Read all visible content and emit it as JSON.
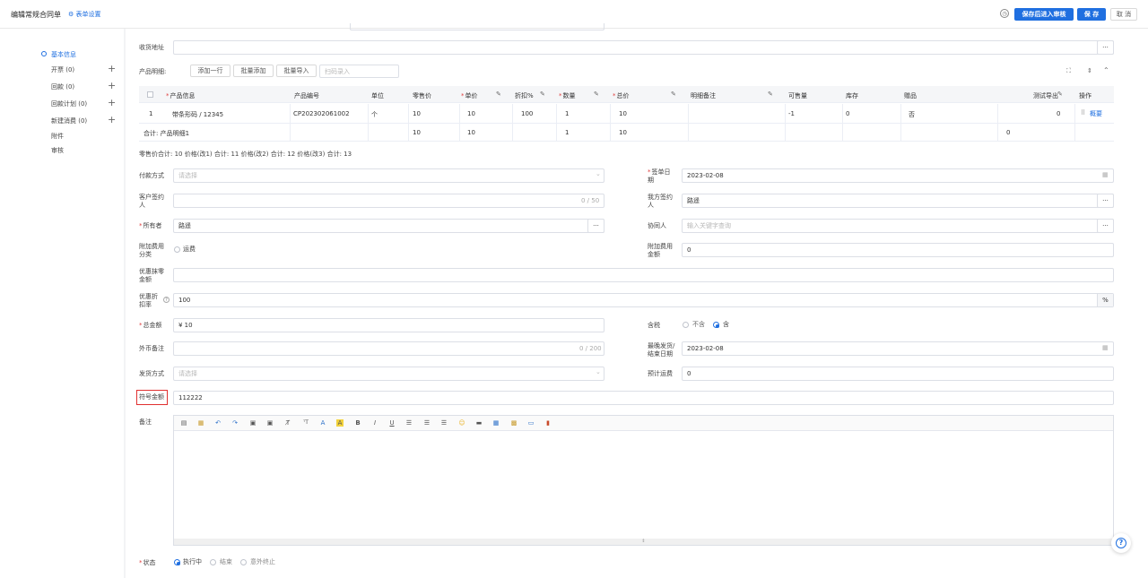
{
  "header": {
    "title": "编辑常规合同单",
    "form_settings": "表单设置",
    "btn_save_review": "保存后进入审核",
    "btn_save": "保 存",
    "btn_cancel": "取 消"
  },
  "sidebar": {
    "items": [
      {
        "label": "基本信息",
        "count": ""
      },
      {
        "label": "开票",
        "count": "(0)"
      },
      {
        "label": "回款",
        "count": "(0)"
      },
      {
        "label": "回款计划",
        "count": "(0)"
      },
      {
        "label": "新建消费",
        "count": "(0)"
      },
      {
        "label": "附件",
        "count": ""
      },
      {
        "label": "审核",
        "count": ""
      }
    ],
    "plus": "+"
  },
  "fields": {
    "shipping_address": {
      "label": "收货地址",
      "value": ""
    },
    "product_detail_label": "产品明细:",
    "add_row": "添加一行",
    "batch_add": "批量添加",
    "batch_import": "批量导入",
    "scan_placeholder": "扫码录入",
    "price_summary": "零售价合计: 10  价格(改1) 合计: 11  价格(改2) 合计: 12  价格(改3) 合计: 13",
    "payment_method": {
      "label": "付款方式",
      "placeholder": "请选择"
    },
    "sign_date": {
      "label": "签单日期",
      "value": "2023-02-08"
    },
    "customer_signer": {
      "label": "客户签约人",
      "counter": "0 / 50"
    },
    "our_signer": {
      "label": "我方签约人",
      "value": "路遥"
    },
    "owner": {
      "label": "所有者",
      "value": "路遥"
    },
    "collaborator": {
      "label": "协同人",
      "placeholder": "输入关键字查询"
    },
    "extra_fee_type": {
      "label": "附加费用分类",
      "option": "运费"
    },
    "extra_fee_amount": {
      "label": "附加费用金额",
      "value": "0"
    },
    "discount_rounding": {
      "label": "优惠抹零金额",
      "value": ""
    },
    "discount_rate": {
      "label": "优惠折扣率",
      "value": "100",
      "unit": "%"
    },
    "total_amount": {
      "label": "总金额",
      "value": "¥ 10"
    },
    "tax_included": {
      "label": "含税",
      "opt_no": "不含",
      "opt_yes": "含"
    },
    "fx_note": {
      "label": "外币备注",
      "counter": "0 / 200"
    },
    "latest_ship_date": {
      "label": "最晚发货/结束日期",
      "value": "2023-02-08"
    },
    "ship_method": {
      "label": "发货方式",
      "placeholder": "请选择"
    },
    "est_freight": {
      "label": "预计运费",
      "value": "0"
    },
    "symbol_amount": {
      "label": "符号金额",
      "value": "112222"
    },
    "remark": {
      "label": "备注"
    },
    "status": {
      "label": "状态",
      "opt1": "执行中",
      "opt2": "结束",
      "opt3": "意外终止"
    }
  },
  "table": {
    "headers": [
      "产品信息",
      "产品编号",
      "单位",
      "零售价",
      "单价",
      "折扣%",
      "数量",
      "总价",
      "明细备注",
      "可售量",
      "库存",
      "赠品",
      "测试导出",
      "操作"
    ],
    "row": {
      "index": "1",
      "product": "带条形码 / 12345",
      "code": "CP202302061002",
      "unit": "个",
      "retail": "10",
      "price": "10",
      "discount": "100",
      "qty": "1",
      "total": "10",
      "note": "",
      "sellable": "-1",
      "stock": "0",
      "gift": "否",
      "test": "0",
      "op": "概要"
    },
    "sum": {
      "label": "合计: 产品明细1",
      "retail": "10",
      "price": "10",
      "qty": "1",
      "total": "10",
      "test": "0"
    }
  },
  "colors": {
    "accent": "#1f6fe0",
    "required": "#e04040",
    "highlight_box": "#e03030"
  }
}
